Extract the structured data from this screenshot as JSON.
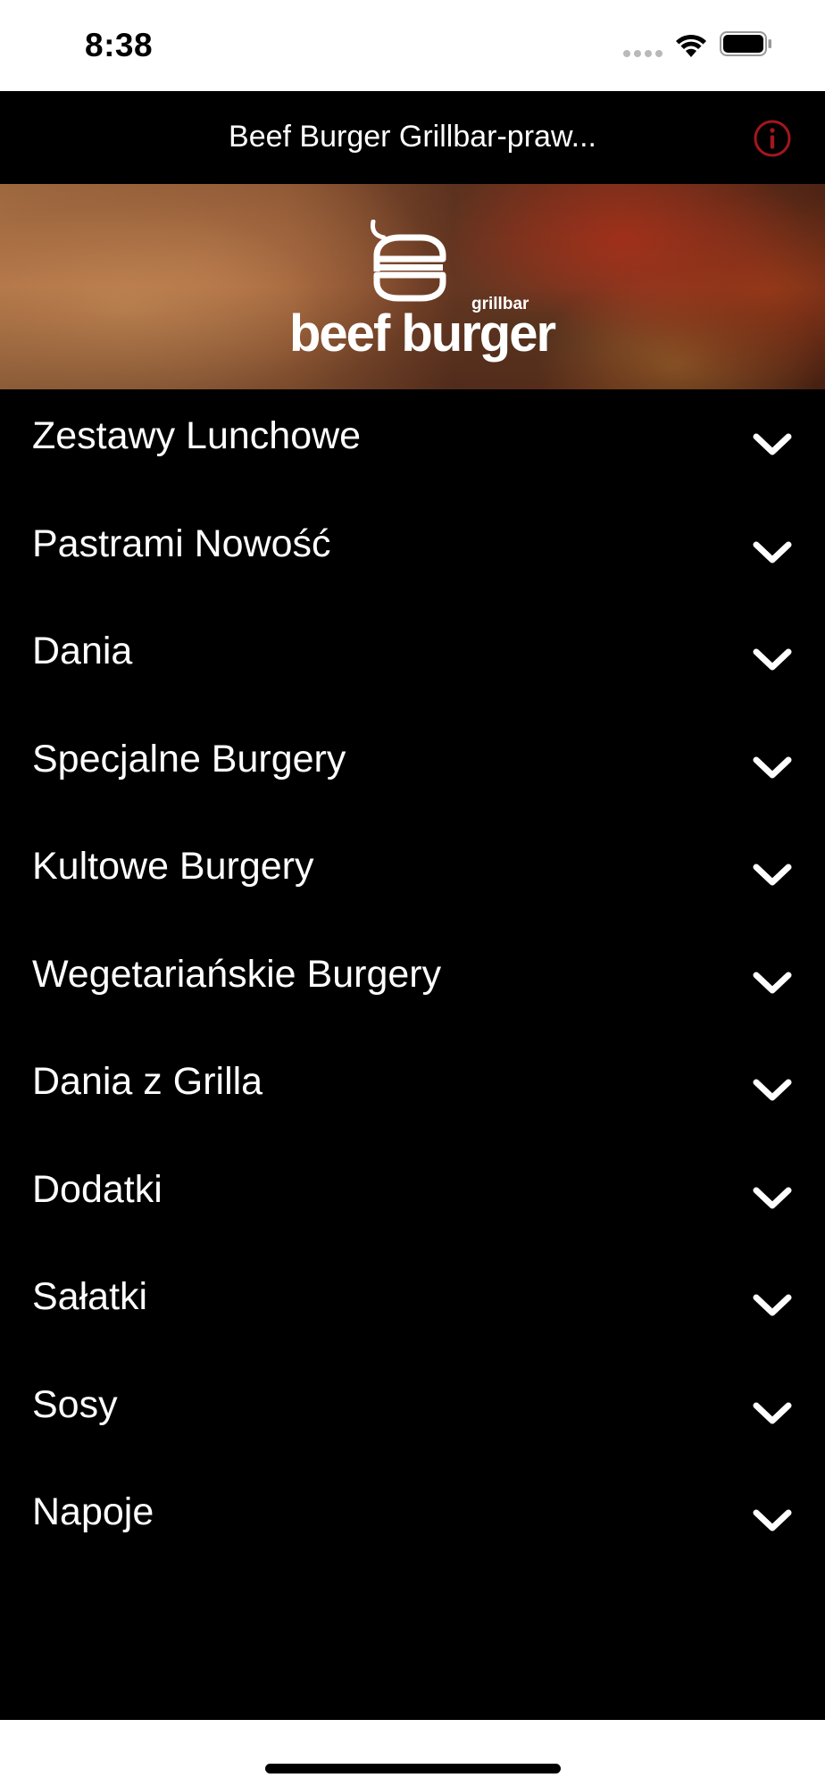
{
  "status_bar": {
    "time": "8:38"
  },
  "nav": {
    "title": "Beef Burger Grillbar-praw...",
    "info_icon": "info-circle-icon",
    "info_color": "#a3161e"
  },
  "banner": {
    "logo_small": "grillbar",
    "logo_text": "beef burger"
  },
  "menu": {
    "chevron_icon": "chevron-down-icon",
    "items": [
      {
        "label": "Zestawy Lunchowe"
      },
      {
        "label": "Pastrami Nowość"
      },
      {
        "label": "Dania"
      },
      {
        "label": "Specjalne Burgery"
      },
      {
        "label": "Kultowe Burgery"
      },
      {
        "label": "Wegetariańskie Burgery"
      },
      {
        "label": "Dania z Grilla"
      },
      {
        "label": "Dodatki"
      },
      {
        "label": "Sałatki"
      },
      {
        "label": "Sosy"
      },
      {
        "label": "Napoje"
      }
    ]
  }
}
